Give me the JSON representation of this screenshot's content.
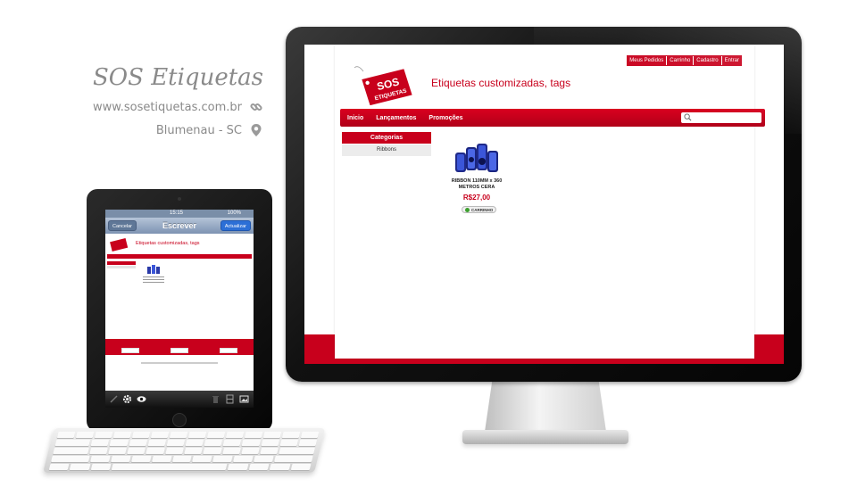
{
  "brand": {
    "title": "SOS Etiquetas",
    "url": "www.sosetiquetas.com.br",
    "city": "Blumenau - SC",
    "link_icon": "link-icon",
    "location_icon": "location-pin-icon"
  },
  "desktop_site": {
    "top_links": [
      "Meus Pedidos",
      "Carrinho",
      "Cadastro",
      "Entrar"
    ],
    "logo_text": [
      "SOS",
      "ETIQUETAS"
    ],
    "tagline": "Etiquetas customizadas, tags",
    "nav": [
      "Inicio",
      "Lançamentos",
      "Promoções"
    ],
    "search_icon": "search-icon",
    "categories_heading": "Categorias",
    "categories": [
      "Ribbons"
    ],
    "product": {
      "name": "RIBBON 110MM x 360 METROS CERA",
      "price": "R$27,00",
      "cart_button": "CARRINHO"
    }
  },
  "tablet": {
    "status_time": "15:15",
    "status_battery": "100%",
    "cancel_label": "Cancelar",
    "title": "Escrever",
    "update_label": "Actualizar",
    "tagline": "Etiquetas customizadas, tags",
    "toolbar_icons": [
      "pencil-icon",
      "gear-icon",
      "eye-icon",
      "trash-icon",
      "film-icon",
      "image-icon"
    ]
  },
  "colors": {
    "brand_red": "#c8001c",
    "brand_gray": "#8a8a8a"
  }
}
